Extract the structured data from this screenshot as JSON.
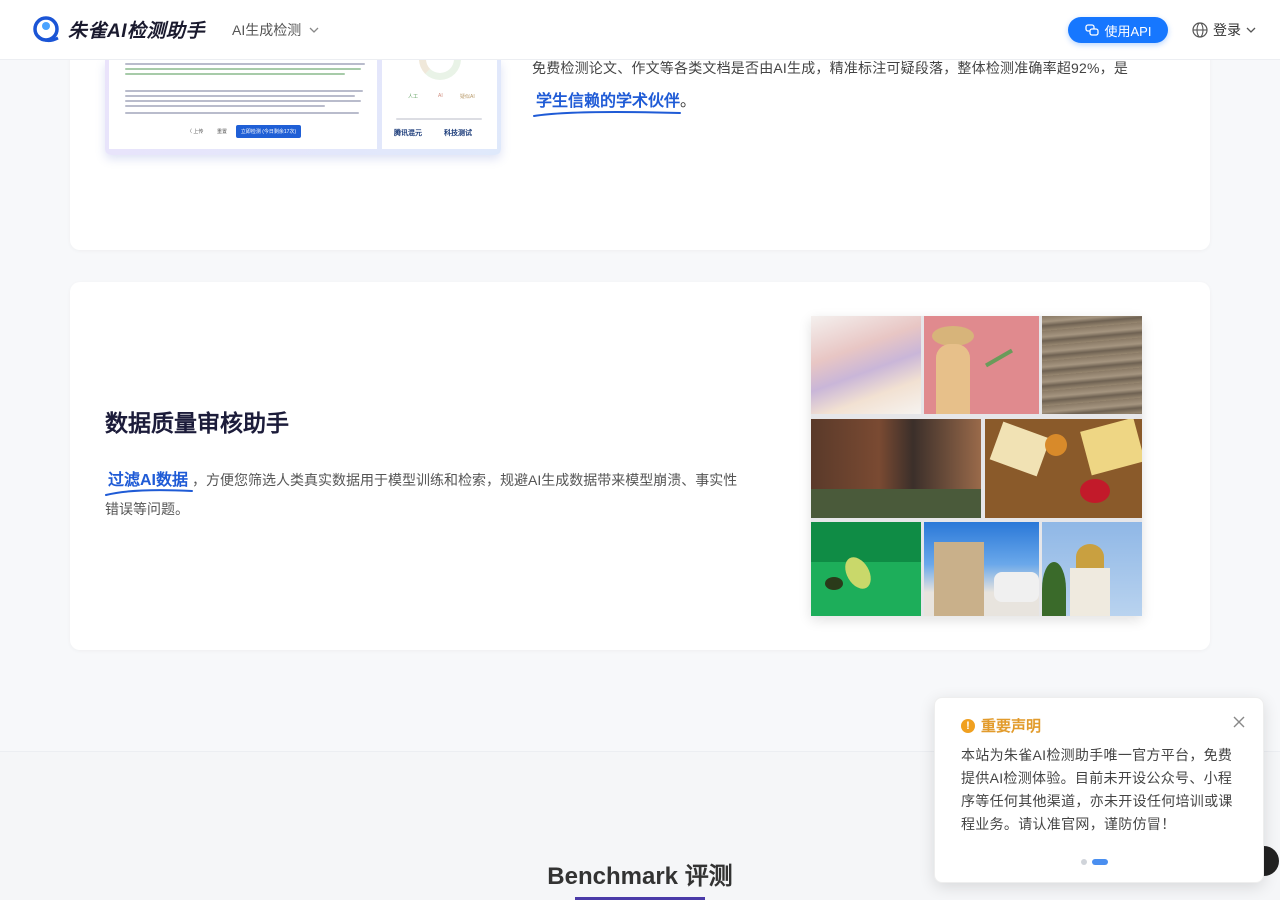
{
  "header": {
    "logo_text": "朱雀AI检测助手",
    "nav_dropdown": "AI生成检测",
    "api_button": "使用API",
    "login_label": "登录"
  },
  "card1": {
    "description": "免费检测论文、作文等各类文档是否由AI生成，精准标注可疑段落，整体检测准确率超92%，是",
    "highlight": "学生信赖的学术伙伴",
    "highlight_suffix": "。",
    "preview": {
      "prev_label": "〈 上传",
      "reset_label": "重置",
      "detect_button": "立即检测 (今日剩余17次)",
      "legend": [
        "人工",
        "AI",
        "疑似AI"
      ],
      "brand_left": "腾讯混元",
      "brand_right": "科技测试"
    }
  },
  "card2": {
    "title": "数据质量审核助手",
    "highlight": "过滤AI数据",
    "body": "，方便您筛选人类真实数据用于模型训练和检索，规避AI生成数据带来模型崩溃、事实性错误等问题。"
  },
  "benchmark": {
    "title": "Benchmark 评测"
  },
  "notice": {
    "title": "重要声明",
    "body": "本站为朱雀AI检测助手唯一官方平台，免费提供AI检测体验。目前未开设公众号、小程序等任何其他渠道，亦未开设任何培训或课程业务。请认准官网，谨防仿冒！"
  },
  "colors": {
    "brand_blue": "#1677ff",
    "highlight_blue": "#1f5bd6",
    "notice_orange": "#e29b2c",
    "title_dark": "#1c1c3a"
  }
}
